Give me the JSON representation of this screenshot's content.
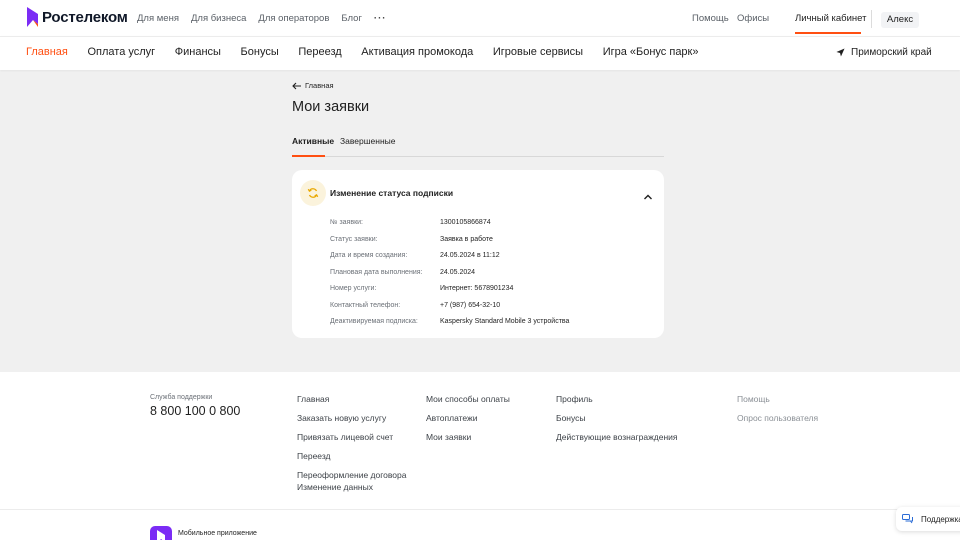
{
  "colors": {
    "accent": "#ff4f12",
    "brand": "#7b2cf5",
    "card_icon_bg": "#fbf3dc",
    "card_icon": "#e9a800"
  },
  "header": {
    "logo_text": "Ростелеком",
    "top_nav": [
      "Для меня",
      "Для бизнеса",
      "Для операторов",
      "Блог"
    ],
    "more_label": "···",
    "help": "Помощь",
    "offices": "Офисы",
    "account": "Личный кабинет",
    "user": "Алекс"
  },
  "main_nav": {
    "items": [
      "Главная",
      "Оплата услуг",
      "Финансы",
      "Бонусы",
      "Переезд",
      "Активация промокода",
      "Игровые сервисы",
      "Игра «Бонус парк»"
    ],
    "active_index": 0,
    "region": "Приморский край"
  },
  "page": {
    "back_label": "Главная",
    "title": "Мои заявки",
    "tabs": [
      "Активные",
      "Завершенные"
    ],
    "active_tab": 0
  },
  "request": {
    "title": "Изменение статуса подписки",
    "icon": "refresh-icon",
    "fields": [
      {
        "label": "№ заявки:",
        "value": "1300105866874"
      },
      {
        "label": "Статус заявки:",
        "value": "Заявка в работе"
      },
      {
        "label": "Дата и время создания:",
        "value": "24.05.2024 в 11:12"
      },
      {
        "label": "Плановая дата выполнения:",
        "value": "24.05.2024"
      },
      {
        "label": "Номер услуги:",
        "value": "Интернет: 5678901234"
      },
      {
        "label": "Контактный телефон:",
        "value": "+7 (987) 654-32-10"
      },
      {
        "label": "Деактивируемая подписка:",
        "value": "Kaspersky Standard Mobile 3 устройства"
      }
    ]
  },
  "footer": {
    "support_label": "Служба поддержки",
    "support_phone": "8 800 100 0 800",
    "col1": [
      "Главная",
      "Заказать новую услугу",
      "Привязать лицевой счет",
      "Переезд",
      "Переоформление договора"
    ],
    "col1_extra": "Изменение данных",
    "col2": [
      "Мои способы оплаты",
      "Автоплатежи",
      "Мои заявки"
    ],
    "col3": [
      "Профиль",
      "Бонусы",
      "Действующие вознаграждения"
    ],
    "col4": [
      "Помощь",
      "Опрос пользователя"
    ],
    "app_label": "Мобильное приложение",
    "support_button": "Поддержка"
  }
}
